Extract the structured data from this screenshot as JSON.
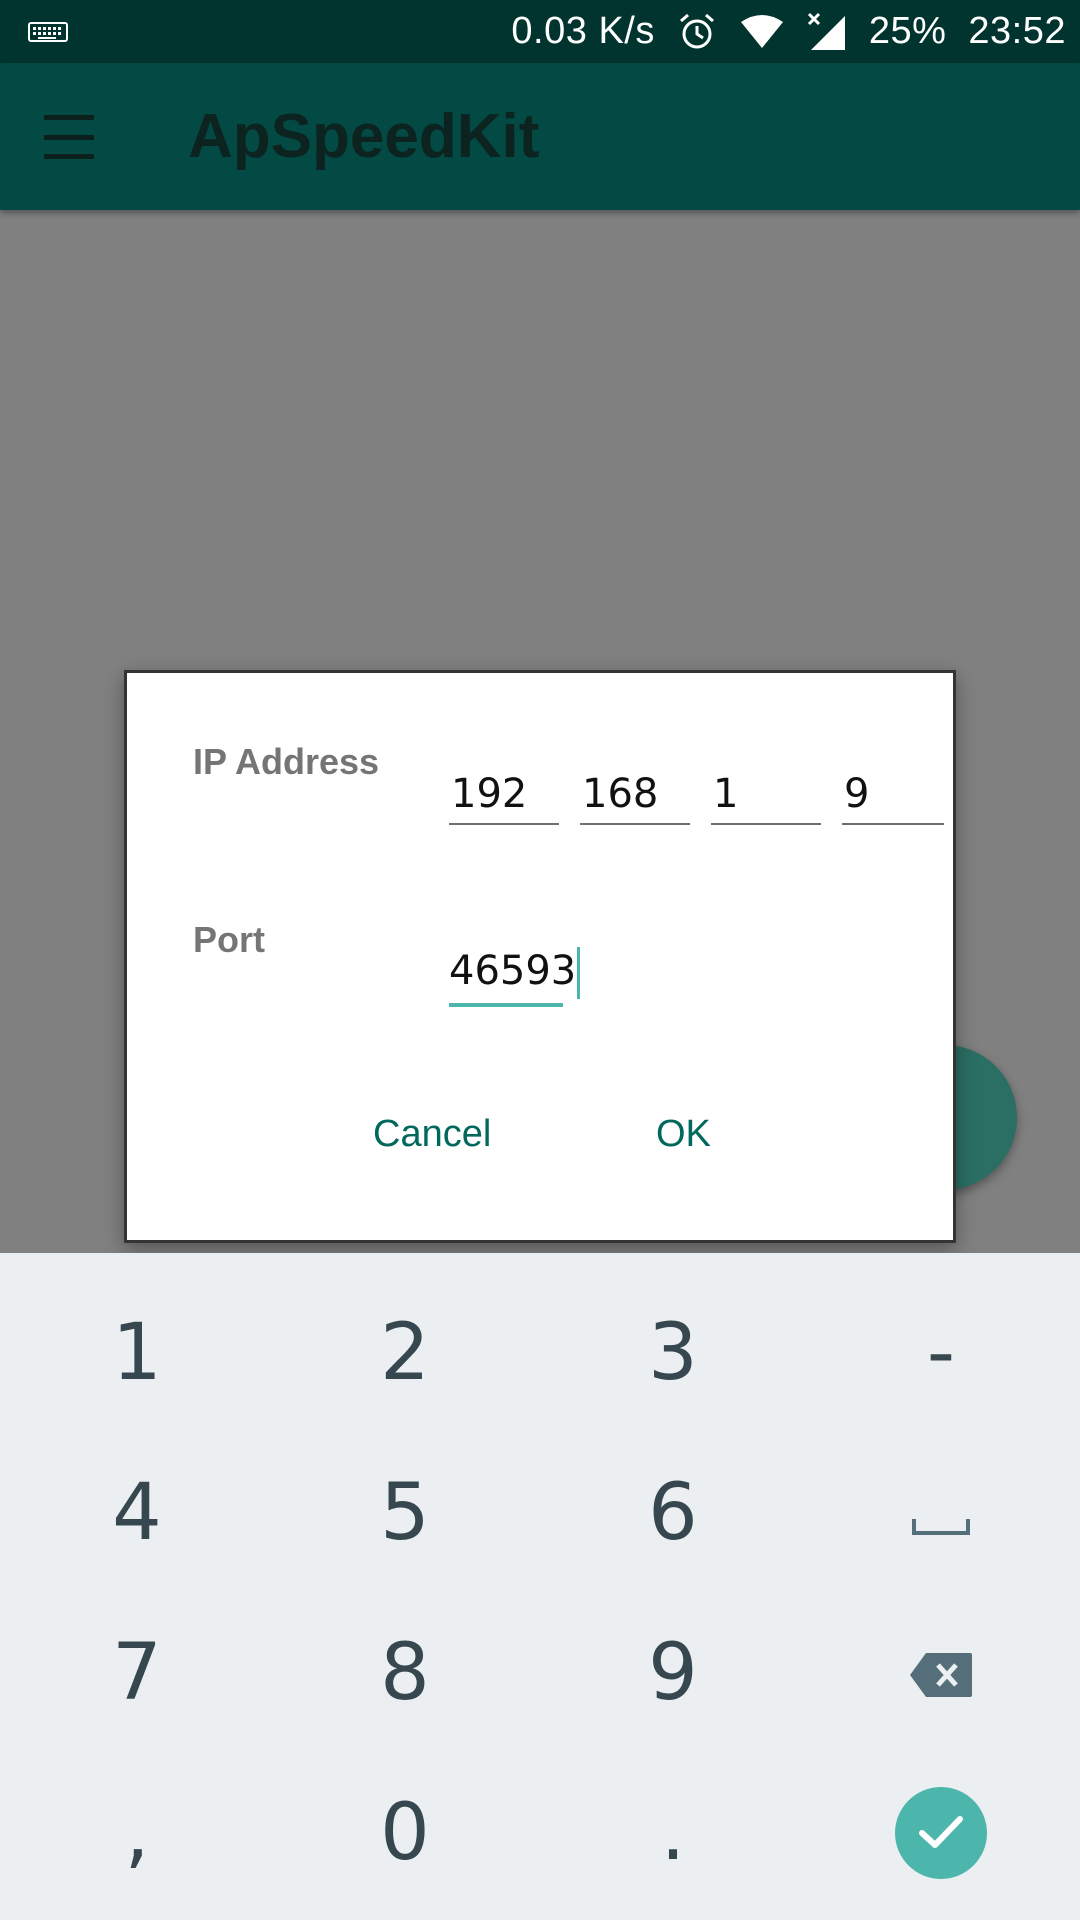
{
  "status_bar": {
    "net_speed": "0.03 K/s",
    "battery": "25%",
    "time": "23:52",
    "icons": [
      "keyboard-icon",
      "alarm-icon",
      "wifi-icon",
      "signal-icon"
    ]
  },
  "app_bar": {
    "title": "ApSpeedKit",
    "menu_icon": "menu-icon"
  },
  "dialog": {
    "ip_label": "IP Address",
    "ip_octets": [
      "192",
      "168",
      "1",
      "9"
    ],
    "port_label": "Port",
    "port_value": "46593",
    "cancel_label": "Cancel",
    "ok_label": "OK"
  },
  "keyboard": {
    "rows": [
      [
        "1",
        "2",
        "3",
        "-"
      ],
      [
        "4",
        "5",
        "6",
        "space"
      ],
      [
        "7",
        "8",
        "9",
        "backspace"
      ],
      [
        ",",
        "0",
        ".",
        "done"
      ]
    ],
    "accent_color": "#4db6ac"
  },
  "colors": {
    "status_bar": "#01342e",
    "app_bar": "#024a43",
    "accent": "#4db6ac",
    "dialog_button": "#00695c"
  }
}
